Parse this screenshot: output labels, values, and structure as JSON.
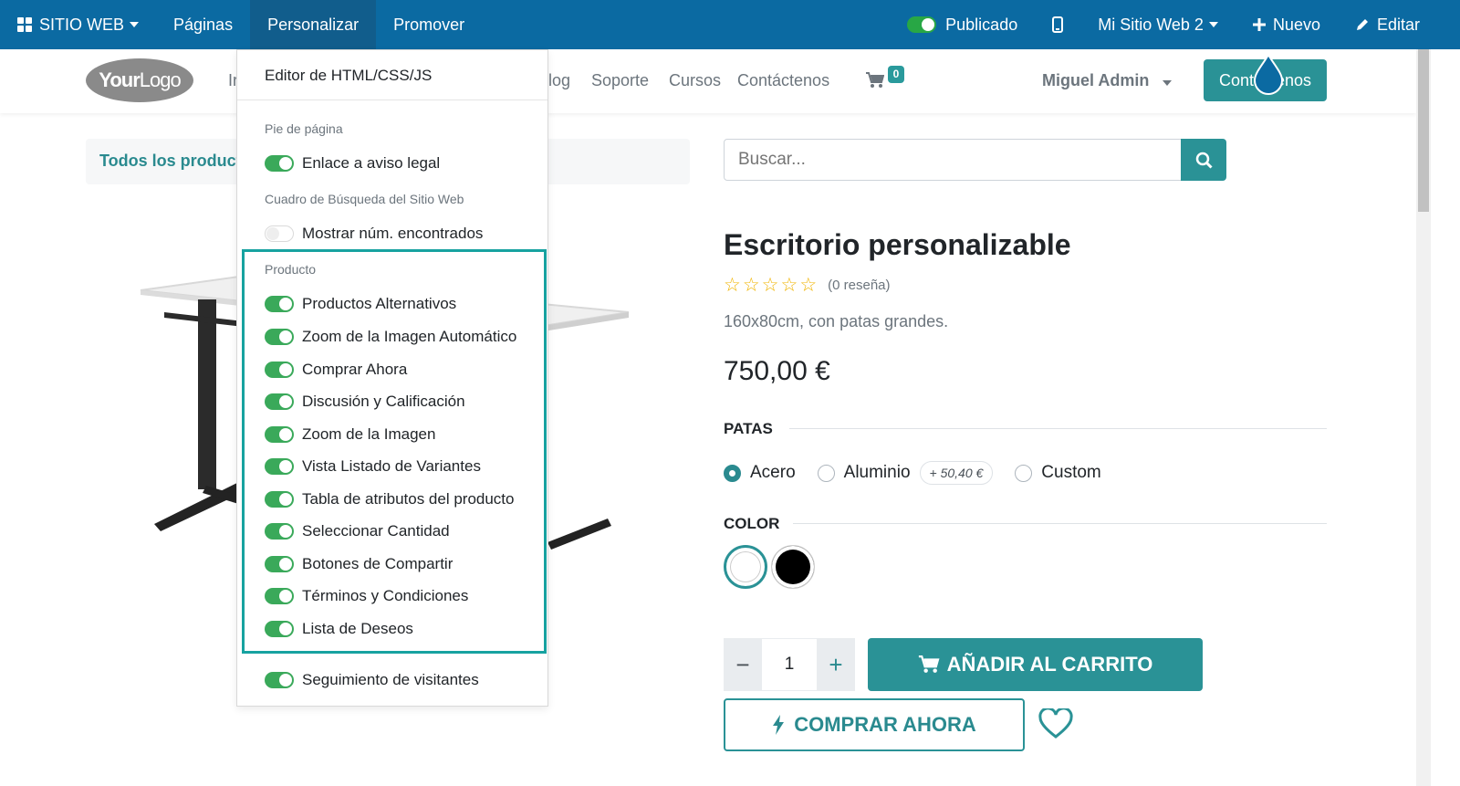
{
  "topbar": {
    "app_menu": "SITIO WEB",
    "pages": "Páginas",
    "customize": "Personalizar",
    "promote": "Promover",
    "published": "Publicado",
    "website_selector": "Mi Sitio Web 2",
    "new": "Nuevo",
    "edit": "Editar"
  },
  "header": {
    "logo_bold": "Your",
    "logo_light": "Logo",
    "nav_partial_left": "Ir",
    "nav": [
      "Blog",
      "Soporte",
      "Cursos",
      "Contáctenos"
    ],
    "nav_blog_partial": "log",
    "cart_count": "0",
    "user": "Miguel Admin",
    "contact_button": "Contáctenos"
  },
  "breadcrumb": {
    "all_products": "Todos los producto"
  },
  "search": {
    "placeholder": "Buscar..."
  },
  "product": {
    "title": "Escritorio personalizable",
    "reviews": "(0 reseña)",
    "rating": 0,
    "rating_max": 5,
    "description": "160x80cm, con patas grandes.",
    "price": "750,00 €",
    "attributes": {
      "legs_label": "PATAS",
      "legs_options": [
        "Acero",
        "Aluminio",
        "Custom"
      ],
      "legs_selected": "Acero",
      "aluminium_extra": "+ 50,40 €",
      "color_label": "COLOR",
      "colors": [
        "#ffffff",
        "#000000"
      ],
      "color_selected": "#ffffff"
    },
    "quantity": "1",
    "add_to_cart": "AÑADIR AL CARRITO",
    "buy_now": "COMPRAR AHORA"
  },
  "dropdown": {
    "html_editor": "Editor de HTML/CSS/JS",
    "footer_header": "Pie de página",
    "legal_link": "Enlace a aviso legal",
    "legal_link_on": true,
    "search_header": "Cuadro de Búsqueda del Sitio Web",
    "show_found": "Mostrar núm. encontrados",
    "show_found_on": false,
    "product_header": "Producto",
    "product_options": [
      {
        "label": "Productos Alternativos",
        "on": true
      },
      {
        "label": "Zoom de la Imagen Automático",
        "on": true
      },
      {
        "label": "Comprar Ahora",
        "on": true
      },
      {
        "label": "Discusión y Calificación",
        "on": true
      },
      {
        "label": "Zoom de la Imagen",
        "on": true
      },
      {
        "label": "Vista Listado de Variantes",
        "on": true
      },
      {
        "label": "Tabla de atributos del producto",
        "on": true
      },
      {
        "label": "Seleccionar Cantidad",
        "on": true
      },
      {
        "label": "Botones de Compartir",
        "on": true
      },
      {
        "label": "Términos y Condiciones",
        "on": true
      },
      {
        "label": "Lista de Deseos",
        "on": true
      }
    ],
    "visitor_tracking": "Seguimiento de visitantes",
    "visitor_tracking_on": true
  },
  "colors": {
    "topbar": "#0b6aa2",
    "accent": "#2a9296",
    "toggle_on": "#3aa95a",
    "highlight": "#17a2a0"
  }
}
